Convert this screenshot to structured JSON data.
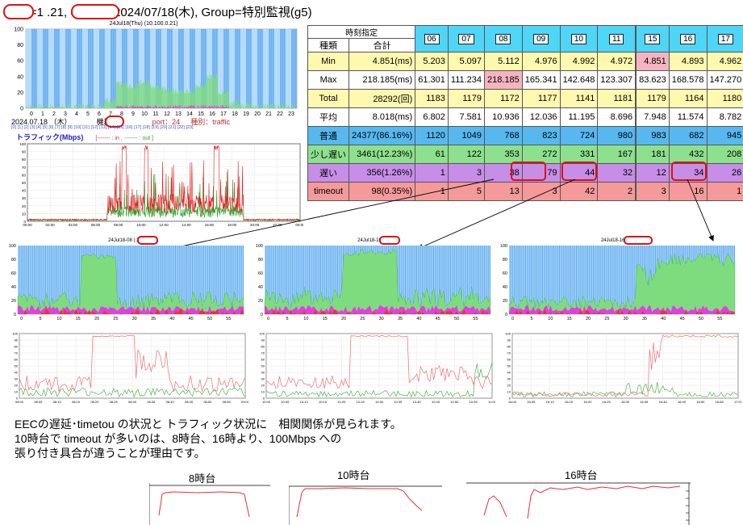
{
  "header": {
    "title": "e, IP=1        .21, 年月日=2024/07/18(木), Group=特別監視(g5)"
  },
  "main_chart": {
    "title": "24Jul18(Thu) (10.100.0.21)",
    "yticks": [
      "100",
      "80",
      "60",
      "40",
      "20",
      "0"
    ],
    "xticks": [
      "0",
      "1",
      "2",
      "3",
      "4",
      "5",
      "6",
      "7",
      "8",
      "9",
      "10",
      "11",
      "12",
      "13",
      "14",
      "15",
      "16",
      "17",
      "18",
      "19",
      "20",
      "21",
      "22",
      "23"
    ]
  },
  "info": {
    "date": "2024.07.18 （木）",
    "device_label": "機器名：",
    "port": "port：24",
    "type": "種別：traffic",
    "hour_links": "[0] [1] [2] [3] [4] [5] [6] [7] [8] [9] [10] [11] [12] [13] [14] [15] [16] [17] [18] [19] [20] [21] [22] [23]"
  },
  "traffic_chart": {
    "title": "トラフィック(Mbps)",
    "legend_in": "[------- : in ,",
    "legend_out": "------- : out ]",
    "yticks": [
      "100",
      "90",
      "80",
      "70",
      "60",
      "50",
      "40",
      "30",
      "20",
      "10",
      "0"
    ],
    "xticks": [
      "00:00",
      "02:00",
      "04:00",
      "06:00",
      "08:00",
      "10:00",
      "12:00",
      "14:00",
      "16:00",
      "18:00",
      "20:00",
      "22:00",
      "00:00"
    ]
  },
  "stats_table": {
    "header_label": "時刻指定",
    "col_type": "種類",
    "col_total": "合計",
    "hours": [
      "06",
      "07",
      "08",
      "09",
      "10",
      "11",
      "15",
      "16",
      "17"
    ],
    "rows": [
      {
        "label": "Min",
        "total": "4.851(ms)",
        "values": [
          "5.203",
          "5.097",
          "5.112",
          "4.976",
          "4.992",
          "4.972",
          "4.851",
          "4.893",
          "4.962"
        ]
      },
      {
        "label": "Max",
        "total": "218.185(ms)",
        "values": [
          "61.301",
          "111.234",
          "218.185",
          "165.341",
          "142.648",
          "123.307",
          "83.623",
          "168.578",
          "147.270"
        ]
      },
      {
        "label": "Total",
        "total": "28292(回)",
        "values": [
          "1183",
          "1179",
          "1172",
          "1177",
          "1141",
          "1181",
          "1179",
          "1164",
          "1180"
        ]
      },
      {
        "label": "平均",
        "total": "8.018(ms)",
        "values": [
          "6.802",
          "7.581",
          "10.936",
          "12.036",
          "11.195",
          "8.696",
          "7.948",
          "11.574",
          "8.782"
        ]
      },
      {
        "label": "普通",
        "total": "24377(86.16%)",
        "values": [
          "1120",
          "1049",
          "768",
          "823",
          "724",
          "980",
          "983",
          "682",
          "945"
        ]
      },
      {
        "label": "少し遅い",
        "total": "3461(12.23%)",
        "values": [
          "61",
          "122",
          "353",
          "272",
          "331",
          "167",
          "181",
          "432",
          "208"
        ]
      },
      {
        "label": "遅い",
        "total": "356(1.26%)",
        "values": [
          "1",
          "3",
          "38",
          "79",
          "44",
          "32",
          "12",
          "34",
          "26"
        ]
      },
      {
        "label": "timeout",
        "total": "98(0.35%)",
        "values": [
          "1",
          "5",
          "13",
          "3",
          "42",
          "2",
          "3",
          "16",
          "1"
        ]
      }
    ]
  },
  "mini_charts": [
    {
      "title": "24Jul18-08 (        21)",
      "xticks": [
        "0",
        "5",
        "10",
        "15",
        "20",
        "25",
        "30",
        "35",
        "40",
        "45",
        "50",
        "55"
      ]
    },
    {
      "title": "24Jul18-10 (        21)",
      "xticks": [
        "0",
        "5",
        "10",
        "15",
        "20",
        "25",
        "30",
        "35",
        "40",
        "45",
        "50",
        "55"
      ]
    },
    {
      "title": "24Jul18-16 (        1)",
      "xticks": [
        "0",
        "5",
        "10",
        "15",
        "20",
        "25",
        "30",
        "35",
        "40",
        "45",
        "50",
        "55"
      ]
    }
  ],
  "mini_yticks": [
    "100",
    "80",
    "60",
    "40",
    "20",
    "0"
  ],
  "traffic_minis": [
    {
      "xticks": [
        "08:00",
        "08:05",
        "08:10",
        "08:15",
        "08:20",
        "08:25",
        "08:30",
        "08:35",
        "08:40",
        "08:45",
        "08:50",
        "08:55",
        "09:00"
      ]
    },
    {
      "xticks": [
        "10:00",
        "10:05",
        "10:10",
        "10:15",
        "10:20",
        "10:25",
        "10:30",
        "10:35",
        "10:40",
        "10:45",
        "10:50",
        "10:55",
        "11:00"
      ]
    },
    {
      "xticks": [
        "16:00",
        "16:05",
        "16:10",
        "16:15",
        "16:20",
        "16:25",
        "16:30",
        "16:35",
        "16:40",
        "16:45",
        "16:50",
        "16:55",
        "17:00"
      ]
    }
  ],
  "traffic_mini_yticks": [
    "100",
    "90",
    "80",
    "70",
    "60",
    "50",
    "40",
    "30",
    "20",
    "10",
    "0"
  ],
  "comment": {
    "line1": "EECの遅延･timetou の状況と トラフィック状況に　相関関係が見られます。",
    "line2": "10時台で timeout が多いのは、8時台、16時より、100Mbps への",
    "line3": "張り付き具合が違うことが理由です。"
  },
  "zoom_labels": [
    "8時台",
    "10時台",
    "16時台"
  ],
  "colors": {
    "normal": "#8ec8f5",
    "slightly_slow": "#7edc7e",
    "slow": "#e040e0",
    "timeout": "#f03030",
    "in_line": "#e83030",
    "out_line": "#30b030",
    "highlight": "#e01010"
  }
}
